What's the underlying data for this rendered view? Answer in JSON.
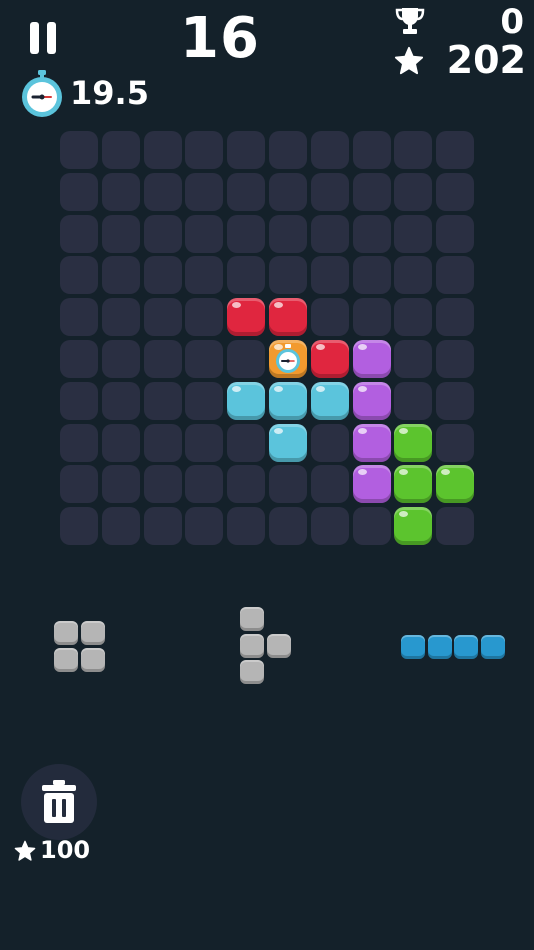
{
  "hud": {
    "score": "16",
    "timer": "19.5",
    "best_score": "0",
    "stars": "202"
  },
  "icons": {
    "pause": "pause-icon",
    "timer": "stopwatch-icon",
    "best": "trophy-icon",
    "stars": "star-icon",
    "trash": "trash-icon"
  },
  "colors": {
    "background": "#14212a",
    "empty_cell": "#2a2f42",
    "red": "#e0263f",
    "cyan": "#5bc4dc",
    "purple": "#b25fe0",
    "green": "#5cc42e",
    "gray": "#b5b5b5",
    "blue": "#2898cf",
    "special": "#f29a2e"
  },
  "board": {
    "rows": 10,
    "cols": 10,
    "filled": [
      {
        "row": 4,
        "col": 4,
        "color": "red"
      },
      {
        "row": 4,
        "col": 5,
        "color": "red"
      },
      {
        "row": 5,
        "col": 5,
        "color": "special"
      },
      {
        "row": 5,
        "col": 6,
        "color": "red"
      },
      {
        "row": 5,
        "col": 7,
        "color": "purple"
      },
      {
        "row": 6,
        "col": 4,
        "color": "cyan"
      },
      {
        "row": 6,
        "col": 5,
        "color": "cyan"
      },
      {
        "row": 6,
        "col": 6,
        "color": "cyan"
      },
      {
        "row": 6,
        "col": 7,
        "color": "purple"
      },
      {
        "row": 7,
        "col": 5,
        "color": "cyan"
      },
      {
        "row": 7,
        "col": 7,
        "color": "purple"
      },
      {
        "row": 7,
        "col": 8,
        "color": "green"
      },
      {
        "row": 8,
        "col": 7,
        "color": "purple"
      },
      {
        "row": 8,
        "col": 8,
        "color": "green"
      },
      {
        "row": 8,
        "col": 9,
        "color": "green"
      },
      {
        "row": 9,
        "col": 8,
        "color": "green"
      }
    ]
  },
  "pieces": [
    {
      "name": "square-piece",
      "color": "gray",
      "cells": [
        [
          0,
          0
        ],
        [
          0,
          1
        ],
        [
          1,
          0
        ],
        [
          1,
          1
        ]
      ]
    },
    {
      "name": "t-piece",
      "color": "gray",
      "cells": [
        [
          0,
          0
        ],
        [
          1,
          0
        ],
        [
          1,
          1
        ],
        [
          2,
          0
        ]
      ]
    },
    {
      "name": "line-piece",
      "color": "blue",
      "cells": [
        [
          0,
          0
        ],
        [
          0,
          1
        ],
        [
          0,
          2
        ],
        [
          0,
          3
        ]
      ]
    }
  ],
  "trash": {
    "cost": "100"
  }
}
